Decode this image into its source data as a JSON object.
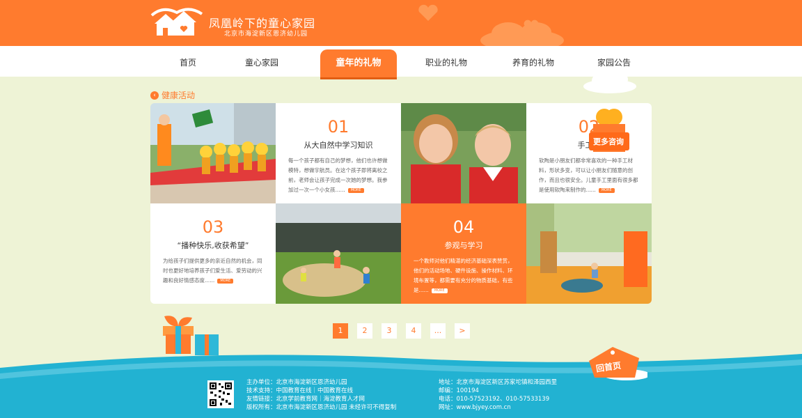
{
  "header": {
    "title": "凤凰岭下的童心家园",
    "subtitle": "北京市海淀新区恩济幼儿园"
  },
  "nav": {
    "items": [
      "首页",
      "童心家园",
      "童年的礼物",
      "职业的礼物",
      "养育的礼物",
      "家园公告"
    ],
    "active_index": 2
  },
  "section": {
    "title": "健康活动"
  },
  "cards": [
    {
      "num": "01",
      "title": "从大自然中学习知识",
      "desc": "每一个孩子都有自己的梦想，他们也许想做模特，想做宇航员。在这个孩子即将离校之前，老师会让孩子完成一次她的梦想。我参加过一次一个小女孩......"
    },
    {
      "num": "02",
      "title": "手工软",
      "desc": "软陶是小朋友们都非常喜欢的一种手工材料，形状多变，可以让小朋友们随意的创作，而且也很安全。儿童手工里面有很多都是使用软陶来制作的......"
    },
    {
      "num": "03",
      "title": "“播种快乐,收获希望”",
      "desc": "为给孩子们提供更多的亲近自然的机会，同时也更好地培养孩子们爱生活、爱劳动的兴趣和良好情感态度......"
    },
    {
      "num": "04",
      "title": "参观与学习",
      "desc": "一个教师对他们精湛的经济基础深表赞赏，他们的活动场地、硬件设施、操作材料、环境布置等，都需要有充分的物质基础，有些是......"
    }
  ],
  "more_label": "MORE",
  "consult_label": "更多咨询",
  "pagination": {
    "pages": [
      "1",
      "2",
      "3",
      "4",
      "...",
      ">"
    ],
    "current": "1"
  },
  "home_label": "回首页",
  "footer": {
    "left": [
      "主办单位：北京市海淀新区恩济幼儿园",
      "技术支持：中国教育在线｜中国教育在线",
      "友情链接：北京学前教育网｜海淀教育人才网",
      "版权所有：北京市海淀新区恩济幼儿园   未经许可不得复制"
    ],
    "right": [
      "地址：北京市海淀区新区苏家坨镇和泽园西里",
      "邮编：100194",
      "电话：010-57523192、010-57533139",
      "网址：www.bjyey.com.cn"
    ]
  },
  "colors": {
    "brand": "#ff7b2e",
    "footer": "#22b2d2",
    "page_bg": "#eef3d6"
  }
}
